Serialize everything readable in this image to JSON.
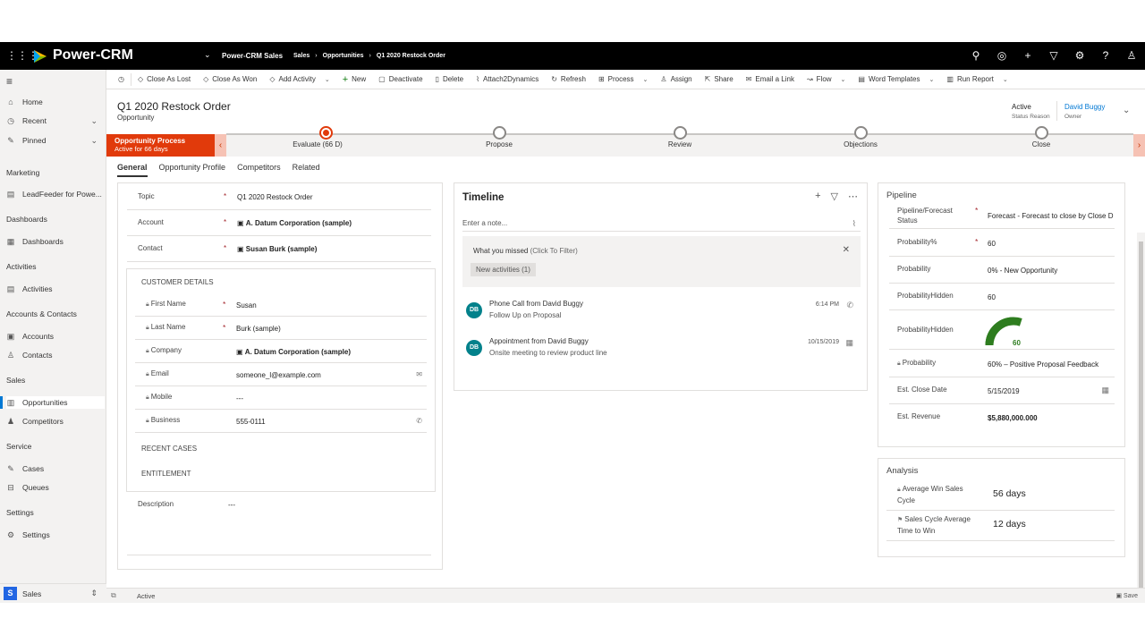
{
  "topbar": {
    "brand": "Power-CRM",
    "app_name": "Power-CRM Sales",
    "crumbs": [
      "Sales",
      "Opportunities",
      "Q1 2020 Restock Order"
    ]
  },
  "sidebar": {
    "items": [
      {
        "label": "Home",
        "icon": "home-icon"
      },
      {
        "label": "Recent",
        "icon": "clock-icon"
      },
      {
        "label": "Pinned",
        "icon": "pin-icon"
      }
    ],
    "groups": [
      {
        "heading": "Marketing",
        "items": [
          "LeadFeeder for Powe..."
        ]
      },
      {
        "heading": "Dashboards",
        "items": [
          "Dashboards"
        ]
      },
      {
        "heading": "Activities",
        "items": [
          "Activities"
        ]
      },
      {
        "heading": "Accounts & Contacts",
        "items": [
          "Accounts",
          "Contacts"
        ]
      },
      {
        "heading": "Sales",
        "items": [
          "Opportunities",
          "Competitors"
        ]
      },
      {
        "heading": "Service",
        "items": [
          "Cases",
          "Queues"
        ]
      },
      {
        "heading": "Settings",
        "items": [
          "Settings"
        ]
      }
    ],
    "area": {
      "letter": "S",
      "label": "Sales"
    }
  },
  "commands": [
    {
      "label": "Close As Lost"
    },
    {
      "label": "Close As Won"
    },
    {
      "label": "Add Activity"
    },
    {
      "label": "New"
    },
    {
      "label": "Deactivate"
    },
    {
      "label": "Delete"
    },
    {
      "label": "Attach2Dynamics"
    },
    {
      "label": "Refresh"
    },
    {
      "label": "Process"
    },
    {
      "label": "Assign"
    },
    {
      "label": "Share"
    },
    {
      "label": "Email a Link"
    },
    {
      "label": "Flow"
    },
    {
      "label": "Word Templates"
    },
    {
      "label": "Run Report"
    }
  ],
  "header": {
    "title": "Q1 2020 Restock Order",
    "entity": "Opportunity",
    "status_value": "Active",
    "status_label": "Status Reason",
    "owner_value": "David Buggy",
    "owner_label": "Owner"
  },
  "bpf": {
    "process_name": "Opportunity Process",
    "active_for": "Active for 66 days",
    "stages": [
      "Evaluate  (66 D)",
      "Propose",
      "Review",
      "Objections",
      "Close"
    ]
  },
  "tabs": [
    "General",
    "Opportunity Profile",
    "Competitors",
    "Related"
  ],
  "general": {
    "topic_label": "Topic",
    "topic_value": "Q1 2020 Restock Order",
    "account_label": "Account",
    "account_value": "A. Datum Corporation (sample)",
    "contact_label": "Contact",
    "contact_value": "Susan Burk (sample)",
    "customer_details": "CUSTOMER DETAILS",
    "first_name_label": "First Name",
    "first_name_value": "Susan",
    "last_name_label": "Last Name",
    "last_name_value": "Burk (sample)",
    "company_label": "Company",
    "company_value": "A. Datum Corporation (sample)",
    "email_label": "Email",
    "email_value": "someone_l@example.com",
    "mobile_label": "Mobile",
    "mobile_value": "---",
    "business_label": "Business",
    "business_value": "555-0111",
    "recent_cases": "RECENT CASES",
    "entitlement": "ENTITLEMENT",
    "description_label": "Description",
    "description_value": "---"
  },
  "timeline": {
    "title": "Timeline",
    "note_placeholder": "Enter a note...",
    "missed_title": "What you missed",
    "missed_hint": "(Click To Filter)",
    "new_activities": "New activities (1)",
    "activities": [
      {
        "initials": "DB",
        "title": "Phone Call from David Buggy",
        "subtitle": "Follow Up on Proposal",
        "time": "6:14 PM"
      },
      {
        "initials": "DB",
        "title": "Appointment from David Buggy",
        "subtitle": "Onsite meeting to review product line",
        "time": "10/15/2019"
      }
    ]
  },
  "pipeline": {
    "heading": "Pipeline",
    "forecast_label": "Pipeline/Forecast Status",
    "forecast_value": "Forecast - Forecast to close by Close D",
    "prob_pct_label": "Probability%",
    "prob_pct_value": "60",
    "probability_label": "Probability",
    "probability_value": "0% - New Opportunity",
    "prob_hidden_label": "ProbabilityHidden",
    "prob_hidden_value": "60",
    "gauge_label": "ProbabilityHidden",
    "gauge_value": "60",
    "gauge_fraction": 0.6,
    "prob2_label": "Probability",
    "prob2_value": "60% – Positive Proposal Feedback",
    "close_date_label": "Est. Close Date",
    "close_date_value": "5/15/2019",
    "revenue_label": "Est. Revenue",
    "revenue_value": "$5,880,000.000"
  },
  "analysis": {
    "heading": "Analysis",
    "win_cycle_label": "Average Win Sales Cycle",
    "win_cycle_value": "56 days",
    "cycle_time_label": "Sales Cycle Average Time to Win",
    "cycle_time_value": "12 days"
  },
  "footer": {
    "status": "Active",
    "save": "Save"
  },
  "colors": {
    "accent": "#0078d4",
    "bpf": "#e13a0b",
    "gauge": "#2e7d1f",
    "avatar": "#02818b",
    "topbar": "#000000"
  }
}
